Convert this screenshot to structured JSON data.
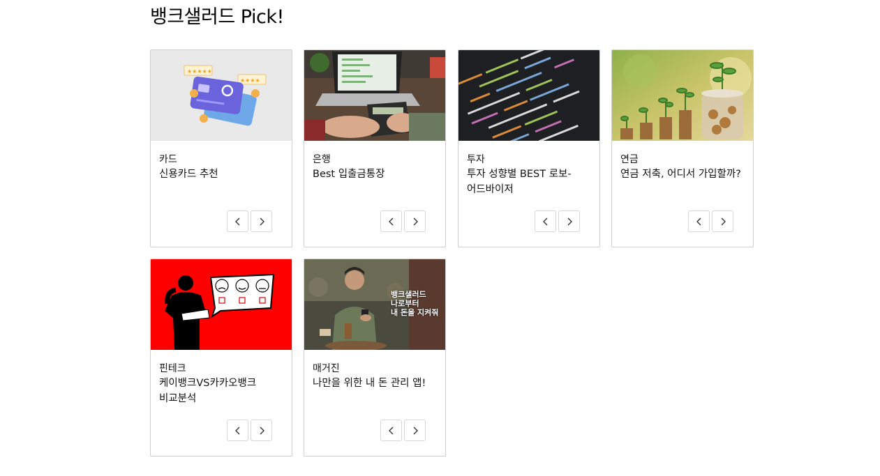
{
  "section": {
    "title": "뱅크샐러드 Pick!"
  },
  "cards": [
    {
      "category": "카드",
      "title": "신용카드 추천",
      "image": "credit-cards-illustration"
    },
    {
      "category": "은행",
      "title": "Best 입출금통장",
      "image": "laptop-calculator-photo"
    },
    {
      "category": "투자",
      "title": "투자 성향별 BEST 로보-어드바이저",
      "image": "code-screen-photo"
    },
    {
      "category": "연금",
      "title": "연금 저축, 어디서 가입할까?",
      "image": "coin-stacks-plants-photo"
    },
    {
      "category": "핀테크",
      "title": "케이뱅크VS카카오뱅크 비교분석",
      "image": "survey-person-illustration"
    },
    {
      "category": "매거진",
      "title": "나만을 위한 내 돈 관리 앱!",
      "image": "cafe-man-phone-photo",
      "overlay_lines": [
        "뱅크샐러드",
        "나로부터",
        "내 돈을 지켜줘"
      ]
    }
  ],
  "nav": {
    "prev_icon": "chevron-left-icon",
    "next_icon": "chevron-right-icon"
  },
  "colors": {
    "border": "#cfcfcf",
    "button_border": "#d6d6d6",
    "text": "#111111"
  }
}
